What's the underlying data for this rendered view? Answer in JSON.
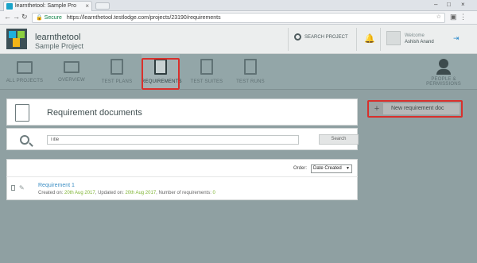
{
  "browser": {
    "tab_title": "learnthetool: Sample Pro",
    "secure_label": "Secure",
    "url": "https://learnthetool.testlodge.com/projects/23190/requirements"
  },
  "app": {
    "brand": "learnthetool",
    "project": "Sample Project",
    "search_project": "SEARCH PROJECT",
    "welcome": "Welcome",
    "user": "Ashish Anand"
  },
  "modules": [
    {
      "label": "ALL PROJECTS"
    },
    {
      "label": "OVERVIEW"
    },
    {
      "label": "TEST PLANS"
    },
    {
      "label": "REQUIREMENTS"
    },
    {
      "label": "TEST SUITES"
    },
    {
      "label": "TEST RUNS"
    },
    {
      "label": "PEOPLE &"
    },
    {
      "label": "PERMISSIONS"
    }
  ],
  "requirements_page": {
    "title": "Requirement documents",
    "new_button": "New requirement doc",
    "plus": "+",
    "search_placeholder": "Title",
    "search_button": "Search",
    "order_label": "Order:",
    "order_value": "Date Created"
  },
  "documents": [
    {
      "name": "Requirement 1",
      "created_label": "Created on:",
      "created": "20th Aug 2017",
      "updated_label": ", Updated on:",
      "updated": "20th Aug 2017",
      "count_label": ", Number of requirements:",
      "count": "0"
    }
  ]
}
